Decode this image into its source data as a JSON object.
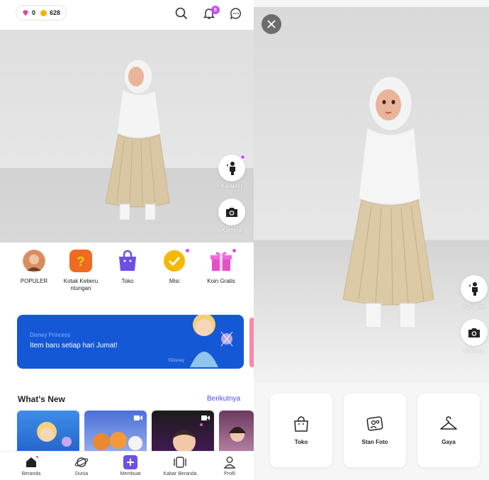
{
  "left": {
    "currency": {
      "gems": "0",
      "coins": "628"
    },
    "notification_count": "5",
    "side_buttons": {
      "character": "Karakter",
      "camera": "Kamera"
    },
    "quick_menu": [
      {
        "label": "POPULER",
        "icon": "avatar-icon"
      },
      {
        "label": "Kotak Keberu ntungan",
        "icon": "lucky-box-icon"
      },
      {
        "label": "Toko",
        "icon": "shop-bag-icon"
      },
      {
        "label": "Misi",
        "icon": "mission-check-icon"
      },
      {
        "label": "Koin Gratis",
        "icon": "gift-icon"
      }
    ],
    "banner": {
      "subtitle": "Disney Princess",
      "title": "Item baru setiap hari Jumat!",
      "copyright": "©Disney"
    },
    "whats_new": {
      "title": "What's New",
      "more": "Berikutnya"
    },
    "nav": [
      {
        "label": "Beranda",
        "icon": "home-icon"
      },
      {
        "label": "Dunia",
        "icon": "planet-icon"
      },
      {
        "label": "Membuat",
        "icon": "plus-icon"
      },
      {
        "label": "Kabar Beranda",
        "icon": "feed-icon"
      },
      {
        "label": "Profil",
        "icon": "profile-icon"
      }
    ]
  },
  "right": {
    "side_buttons": {
      "character": "Karakter",
      "camera": "Kamera"
    },
    "cards": [
      {
        "label": "Toko",
        "icon": "shop-bag-icon"
      },
      {
        "label": "Stan Foto",
        "icon": "photo-booth-icon"
      },
      {
        "label": "Gaya",
        "icon": "hanger-icon"
      }
    ]
  },
  "colors": {
    "accent": "#c44dff",
    "banner": "#1458d6",
    "link": "#4a4af0"
  }
}
